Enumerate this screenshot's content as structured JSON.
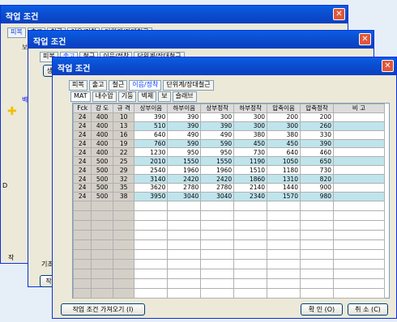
{
  "windows": [
    {
      "title": "작업 조건",
      "tabs": [
        "피복",
        "출고",
        "철근",
        "이음/정착",
        "단위계/장대철근"
      ]
    },
    {
      "title": "작업 조건",
      "tabs": [
        "피복",
        "출고",
        "철근",
        "이음/정착",
        "단위계/장대철근"
      ]
    },
    {
      "title": "작업 조건",
      "tabs": [
        "피복",
        "출고",
        "철근",
        "이음/정착",
        "단위계/장대철근"
      ],
      "subtabs": [
        "MAT",
        "내수압",
        "기둥",
        "벽체",
        "보",
        "슬래브"
      ],
      "buttons": {
        "load": "작업 조건 가져오기 (I)",
        "ok": "확 인 (O)",
        "cancel": "취 소 (C)"
      }
    }
  ],
  "bg_fragments": {
    "w1_labels": [
      "보",
      "벽",
      "D",
      "작"
    ],
    "w2_labels": [
      "생성",
      "기초",
      "작"
    ]
  },
  "table": {
    "headers": [
      "Fck",
      "강 도",
      "규 격",
      "상부이음",
      "하부이음",
      "상부정착",
      "하부정착",
      "압축이음",
      "압축정착",
      "비 고"
    ],
    "rows": [
      [
        "24",
        "400",
        "10",
        "390",
        "390",
        "300",
        "300",
        "200",
        "200",
        ""
      ],
      [
        "24",
        "400",
        "13",
        "510",
        "390",
        "390",
        "300",
        "300",
        "260",
        ""
      ],
      [
        "24",
        "400",
        "16",
        "640",
        "490",
        "490",
        "380",
        "380",
        "330",
        ""
      ],
      [
        "24",
        "400",
        "19",
        "760",
        "590",
        "590",
        "450",
        "450",
        "390",
        ""
      ],
      [
        "24",
        "400",
        "22",
        "1230",
        "950",
        "950",
        "730",
        "640",
        "460",
        ""
      ],
      [
        "24",
        "500",
        "25",
        "2010",
        "1550",
        "1550",
        "1190",
        "1050",
        "650",
        ""
      ],
      [
        "24",
        "500",
        "29",
        "2540",
        "1960",
        "1960",
        "1510",
        "1180",
        "730",
        ""
      ],
      [
        "24",
        "500",
        "32",
        "3140",
        "2420",
        "2420",
        "1860",
        "1310",
        "820",
        ""
      ],
      [
        "24",
        "500",
        "35",
        "3620",
        "2780",
        "2780",
        "2140",
        "1440",
        "900",
        ""
      ],
      [
        "24",
        "500",
        "38",
        "3950",
        "3040",
        "3040",
        "2340",
        "1570",
        "980",
        ""
      ]
    ]
  }
}
